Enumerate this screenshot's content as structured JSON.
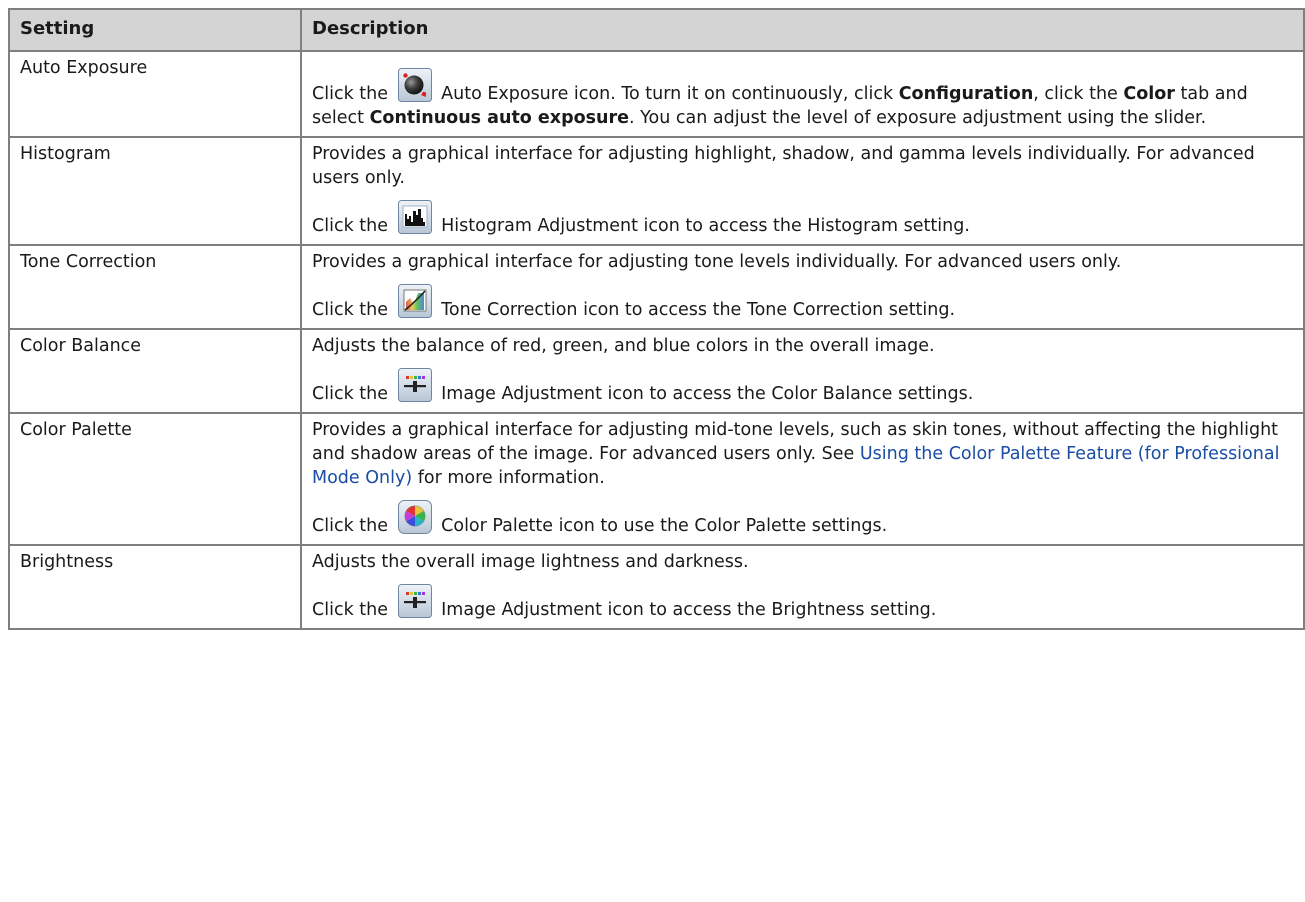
{
  "headers": {
    "setting": "Setting",
    "description": "Description"
  },
  "rows": [
    {
      "setting": "Auto Exposure",
      "p1": {
        "pre": "Click the",
        "icon": "auto-exposure-icon",
        "t1": "Auto Exposure icon. To turn it on continuously, click",
        "b1": "Configuration",
        "t2": ", click the",
        "b2": "Color",
        "t3": "tab and select",
        "b3": "Continuous auto exposure",
        "t4": ". You can adjust the level of exposure adjustment using the slider."
      }
    },
    {
      "setting": "Histogram",
      "p1": "Provides a graphical interface for adjusting highlight, shadow, and gamma levels individually. For advanced users only.",
      "p2": {
        "pre": "Click the",
        "icon": "histogram-icon",
        "post": "Histogram Adjustment icon to access the Histogram setting."
      }
    },
    {
      "setting": "Tone Correction",
      "p1": "Provides a graphical interface for adjusting tone levels individually. For advanced users only.",
      "p2": {
        "pre": "Click the",
        "icon": "tone-correction-icon",
        "post": "Tone Correction icon to access the Tone Correction setting."
      }
    },
    {
      "setting": "Color Balance",
      "p1": "Adjusts the balance of red, green, and blue colors in the overall image.",
      "p2": {
        "pre": "Click the",
        "icon": "image-adjustment-icon",
        "post": "Image Adjustment icon to access the Color Balance settings."
      }
    },
    {
      "setting": "Color Palette",
      "p1": {
        "t1": "Provides a graphical interface for adjusting mid-tone levels, such as skin tones, without affecting the highlight and shadow areas of the image. For advanced users only. See",
        "link": "Using the Color Palette Feature (for Professional Mode Only)",
        "t2": "for more information."
      },
      "p2": {
        "pre": "Click the",
        "icon": "color-palette-icon",
        "post": "Color Palette icon to use the Color Palette settings."
      }
    },
    {
      "setting": "Brightness",
      "p1": "Adjusts the overall image lightness and darkness.",
      "p2": {
        "pre": "Click the",
        "icon": "image-adjustment-icon",
        "post": "Image Adjustment icon to access the Brightness setting."
      }
    }
  ],
  "colors": {
    "header_bg": "#d4d4d4",
    "border": "#7f7f7f",
    "link": "#1a4da3"
  }
}
